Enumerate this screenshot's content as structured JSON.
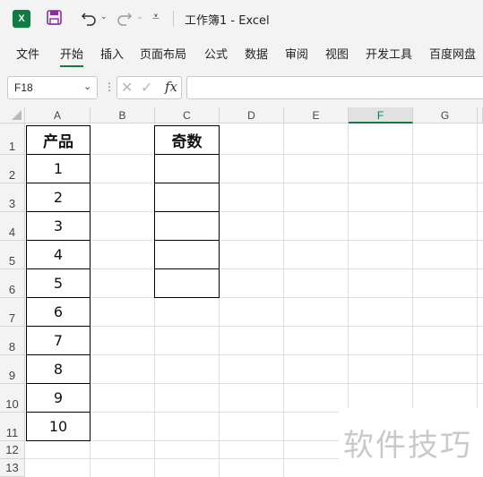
{
  "titlebar": {
    "app_icon_letter": "X",
    "doc_title": "工作簿1  -  Excel",
    "undo_caret": "⌄",
    "redo_caret": "⌄",
    "qat_more": "⩡"
  },
  "ribbon": {
    "tabs": [
      "文件",
      "开始",
      "插入",
      "页面布局",
      "公式",
      "数据",
      "审阅",
      "视图",
      "开发工具",
      "百度网盘"
    ],
    "active_tab": "开始"
  },
  "formula_bar": {
    "name_box": "F18",
    "name_box_caret": "⌄",
    "dots": "⋮",
    "cancel": "✕",
    "enter": "✓",
    "fx": "fx",
    "formula": ""
  },
  "sheet": {
    "columns": [
      "A",
      "B",
      "C",
      "D",
      "E",
      "F",
      "G"
    ],
    "selected_column": "F",
    "rows": [
      "1",
      "2",
      "3",
      "4",
      "5",
      "6",
      "7",
      "8",
      "9",
      "10",
      "11",
      "12",
      "13"
    ],
    "colA": [
      "产品",
      "1",
      "2",
      "3",
      "4",
      "5",
      "6",
      "7",
      "8",
      "9",
      "10"
    ],
    "colC": [
      "奇数",
      "",
      "",
      "",
      "",
      ""
    ]
  },
  "watermark": "软件技巧",
  "colors": {
    "accent": "#107c41"
  }
}
